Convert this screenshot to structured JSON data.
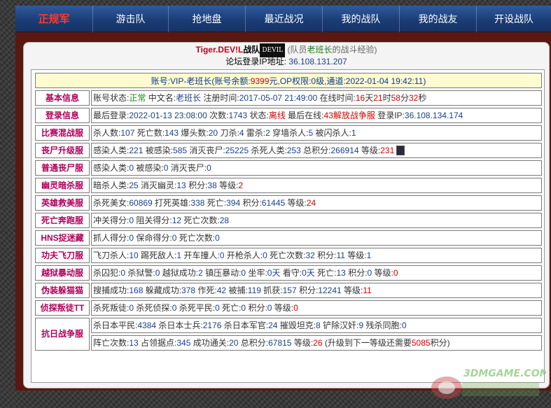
{
  "nav": {
    "logo": "正规军",
    "items": [
      "游击队",
      "抢地盘",
      "最近战况",
      "我的战队",
      "我的战友",
      "开设战队"
    ]
  },
  "header": {
    "player_name": "Tiger.DEV!L",
    "team_label": "战队",
    "team_badge": "DEVIL",
    "sub_prefix": "(队员",
    "sub_name": "老班长",
    "sub_suffix": "的战斗经验)",
    "ip_label": "论坛登录IP地址:",
    "ip_value": "36.108.131.207"
  },
  "account": {
    "l1": "账号:",
    "vip": "VIP-老班长",
    "l2": "(账号余额:",
    "balance": "9399",
    "l3": "元,OP权限:",
    "op": "0",
    "l4": "级,通道:",
    "channel_time": "2022-01-04 19:42:11",
    "l5": ")"
  },
  "basic": {
    "label": "基本信息",
    "t1": "账号状态:",
    "status": "正常",
    "t2": " 中文名:",
    "cn_name": "老班长",
    "t3": " 注册时间:",
    "reg_time": "2017-05-07 21:49:00",
    "t4": " 在线时间:",
    "d": "16",
    "td": "天",
    "h": "21",
    "th": "时",
    "m": "58",
    "tm": "分",
    "s": "32",
    "ts": "秒"
  },
  "login": {
    "label": "登录信息",
    "t1": "最后登录:",
    "last": "2022-01-13 23:08:00",
    "t2": " 次数:",
    "count": "1743",
    "t3": " 状态:",
    "state": "离线",
    "t4": " 最后在线:",
    "last_online": "43解放战争服",
    "t5": " 登录IP:",
    "ip": "36.108.134.174"
  },
  "rows": {
    "bisai": {
      "label": "比赛混战服",
      "t1": "杀人数:",
      "v1": "107",
      "t2": " 死亡数:",
      "v2": "143",
      "t3": " 爆头数:",
      "v3": "20",
      "t4": " 刀杀:",
      "v4": "4",
      "t5": " 雷杀:",
      "v5": "2",
      "t6": " 穿墙杀人:",
      "v6": "5",
      "t7": " 被闪杀人:",
      "v7": "1"
    },
    "sangshi": {
      "label": "丧尸升级服",
      "t1": "感染人类:",
      "v1": "221",
      "t2": " 被感染:",
      "v2": "585",
      "t3": " 消灭丧尸:",
      "v3": "25225",
      "t4": " 杀死人类:",
      "v4": "253",
      "t5": " 总积分:",
      "v5": "266914",
      "t6": " 等级:",
      "v6": "231"
    },
    "putong": {
      "label": "普通丧尸服",
      "t1": "感染人类:",
      "v1": "0",
      "t2": " 被感染:",
      "v2": "0",
      "t3": " 消灭丧尸:",
      "v3": "0"
    },
    "youling": {
      "label": "幽灵暗杀服",
      "t1": "暗杀人类:",
      "v1": "25",
      "t2": " 消灭幽灵:",
      "v2": "13",
      "t3": " 积分:",
      "v3": "38",
      "t4": " 等级:",
      "v4": "2"
    },
    "yingxiong": {
      "label": "英雄救美服",
      "t1": "杀死美女:",
      "v1": "60869",
      "t2": " 打死英雄:",
      "v2": "338",
      "t3": " 死亡:",
      "v3": "394",
      "t4": " 积分:",
      "v4": "61445",
      "t5": " 等级:",
      "v5": "24"
    },
    "siwang": {
      "label": "死亡奔跑服",
      "t1": "冲关得分:",
      "v1": "0",
      "t2": " 阻关得分:",
      "v2": "12",
      "t3": " 死亡次数:",
      "v3": "28"
    },
    "hns": {
      "label": "HNS捉迷藏",
      "t1": "抓人得分:",
      "v1": "0",
      "t2": " 保命得分:",
      "v2": "0",
      "t3": " 死亡次数:",
      "v3": "0"
    },
    "gongfu": {
      "label": "功夫飞刀服",
      "t1": "飞刀杀人:",
      "v1": "10",
      "t2": " 踢死敌人:",
      "v2": "1",
      "t3": " 开车撞人:",
      "v3": "0",
      "t4": " 开枪杀人:",
      "v4": "0",
      "t5": " 死亡次数:",
      "v5": "32",
      "t6": " 积分:",
      "v6": "11",
      "t7": " 等级:",
      "v7": "1"
    },
    "yueyu": {
      "label": "越狱暴动服",
      "t1": "杀囚犯:",
      "v1": "0",
      "t2": " 杀狱警:",
      "v2": "0",
      "t3": " 越狱成功:",
      "v3": "2",
      "t4": " 镇压暴动:",
      "v4": "0",
      "t5": " 坐牢:",
      "v5": "0天",
      "t6": " 看守:",
      "v6": "0天",
      "t7": " 死亡:",
      "v7": "13",
      "t8": " 积分:",
      "v8": "0",
      "t9": " 等级:",
      "v9": "0"
    },
    "weizhuang": {
      "label": "伪装躲猫猫",
      "t1": "搜捕成功:",
      "v1": "168",
      "t2": " 躲藏成功:",
      "v2": "378",
      "t3": " 作死:",
      "v3": "42",
      "t4": " 被捕:",
      "v4": "119",
      "t5": " 抓获:",
      "v5": "157",
      "t6": " 积分:",
      "v6": "12241",
      "t7": " 等级:",
      "v7": "11"
    },
    "zhentan": {
      "label": "侦探叛徒TT",
      "t1": "杀死叛徒:",
      "v1": "0",
      "t2": " 杀死侦探:",
      "v2": "0",
      "t3": " 杀死平民:",
      "v3": "0",
      "t4": " 死亡:",
      "v4": "0",
      "t5": " 积分:",
      "v5": "0",
      "t6": " 等级:",
      "v6": "0"
    },
    "kangri": {
      "label": "抗日战争服",
      "a1": "杀日本平民:",
      "av1": "4384",
      "a2": " 杀日本士兵:",
      "av2": "2176",
      "a3": " 杀日本军官:",
      "av3": "24",
      "a4": " 摧毁坦克:",
      "av4": "8",
      "a5": " 铲除汉奸:",
      "av5": "9",
      "a6": " 残杀同胞:",
      "av6": "0",
      "b1": "阵亡次数:",
      "bv1": "13",
      "b2": " 占领据点:",
      "bv2": "345",
      "b3": " 成功通关:",
      "bv3": "20",
      "b4": " 总积分:",
      "bv4": "67815",
      "b5": " 等级:",
      "bv5": "26",
      "b6": " (升级到下一等级还需要",
      "bv6": "5085",
      "b7": "积分)"
    }
  },
  "watermark": "3DMGAME.COM"
}
